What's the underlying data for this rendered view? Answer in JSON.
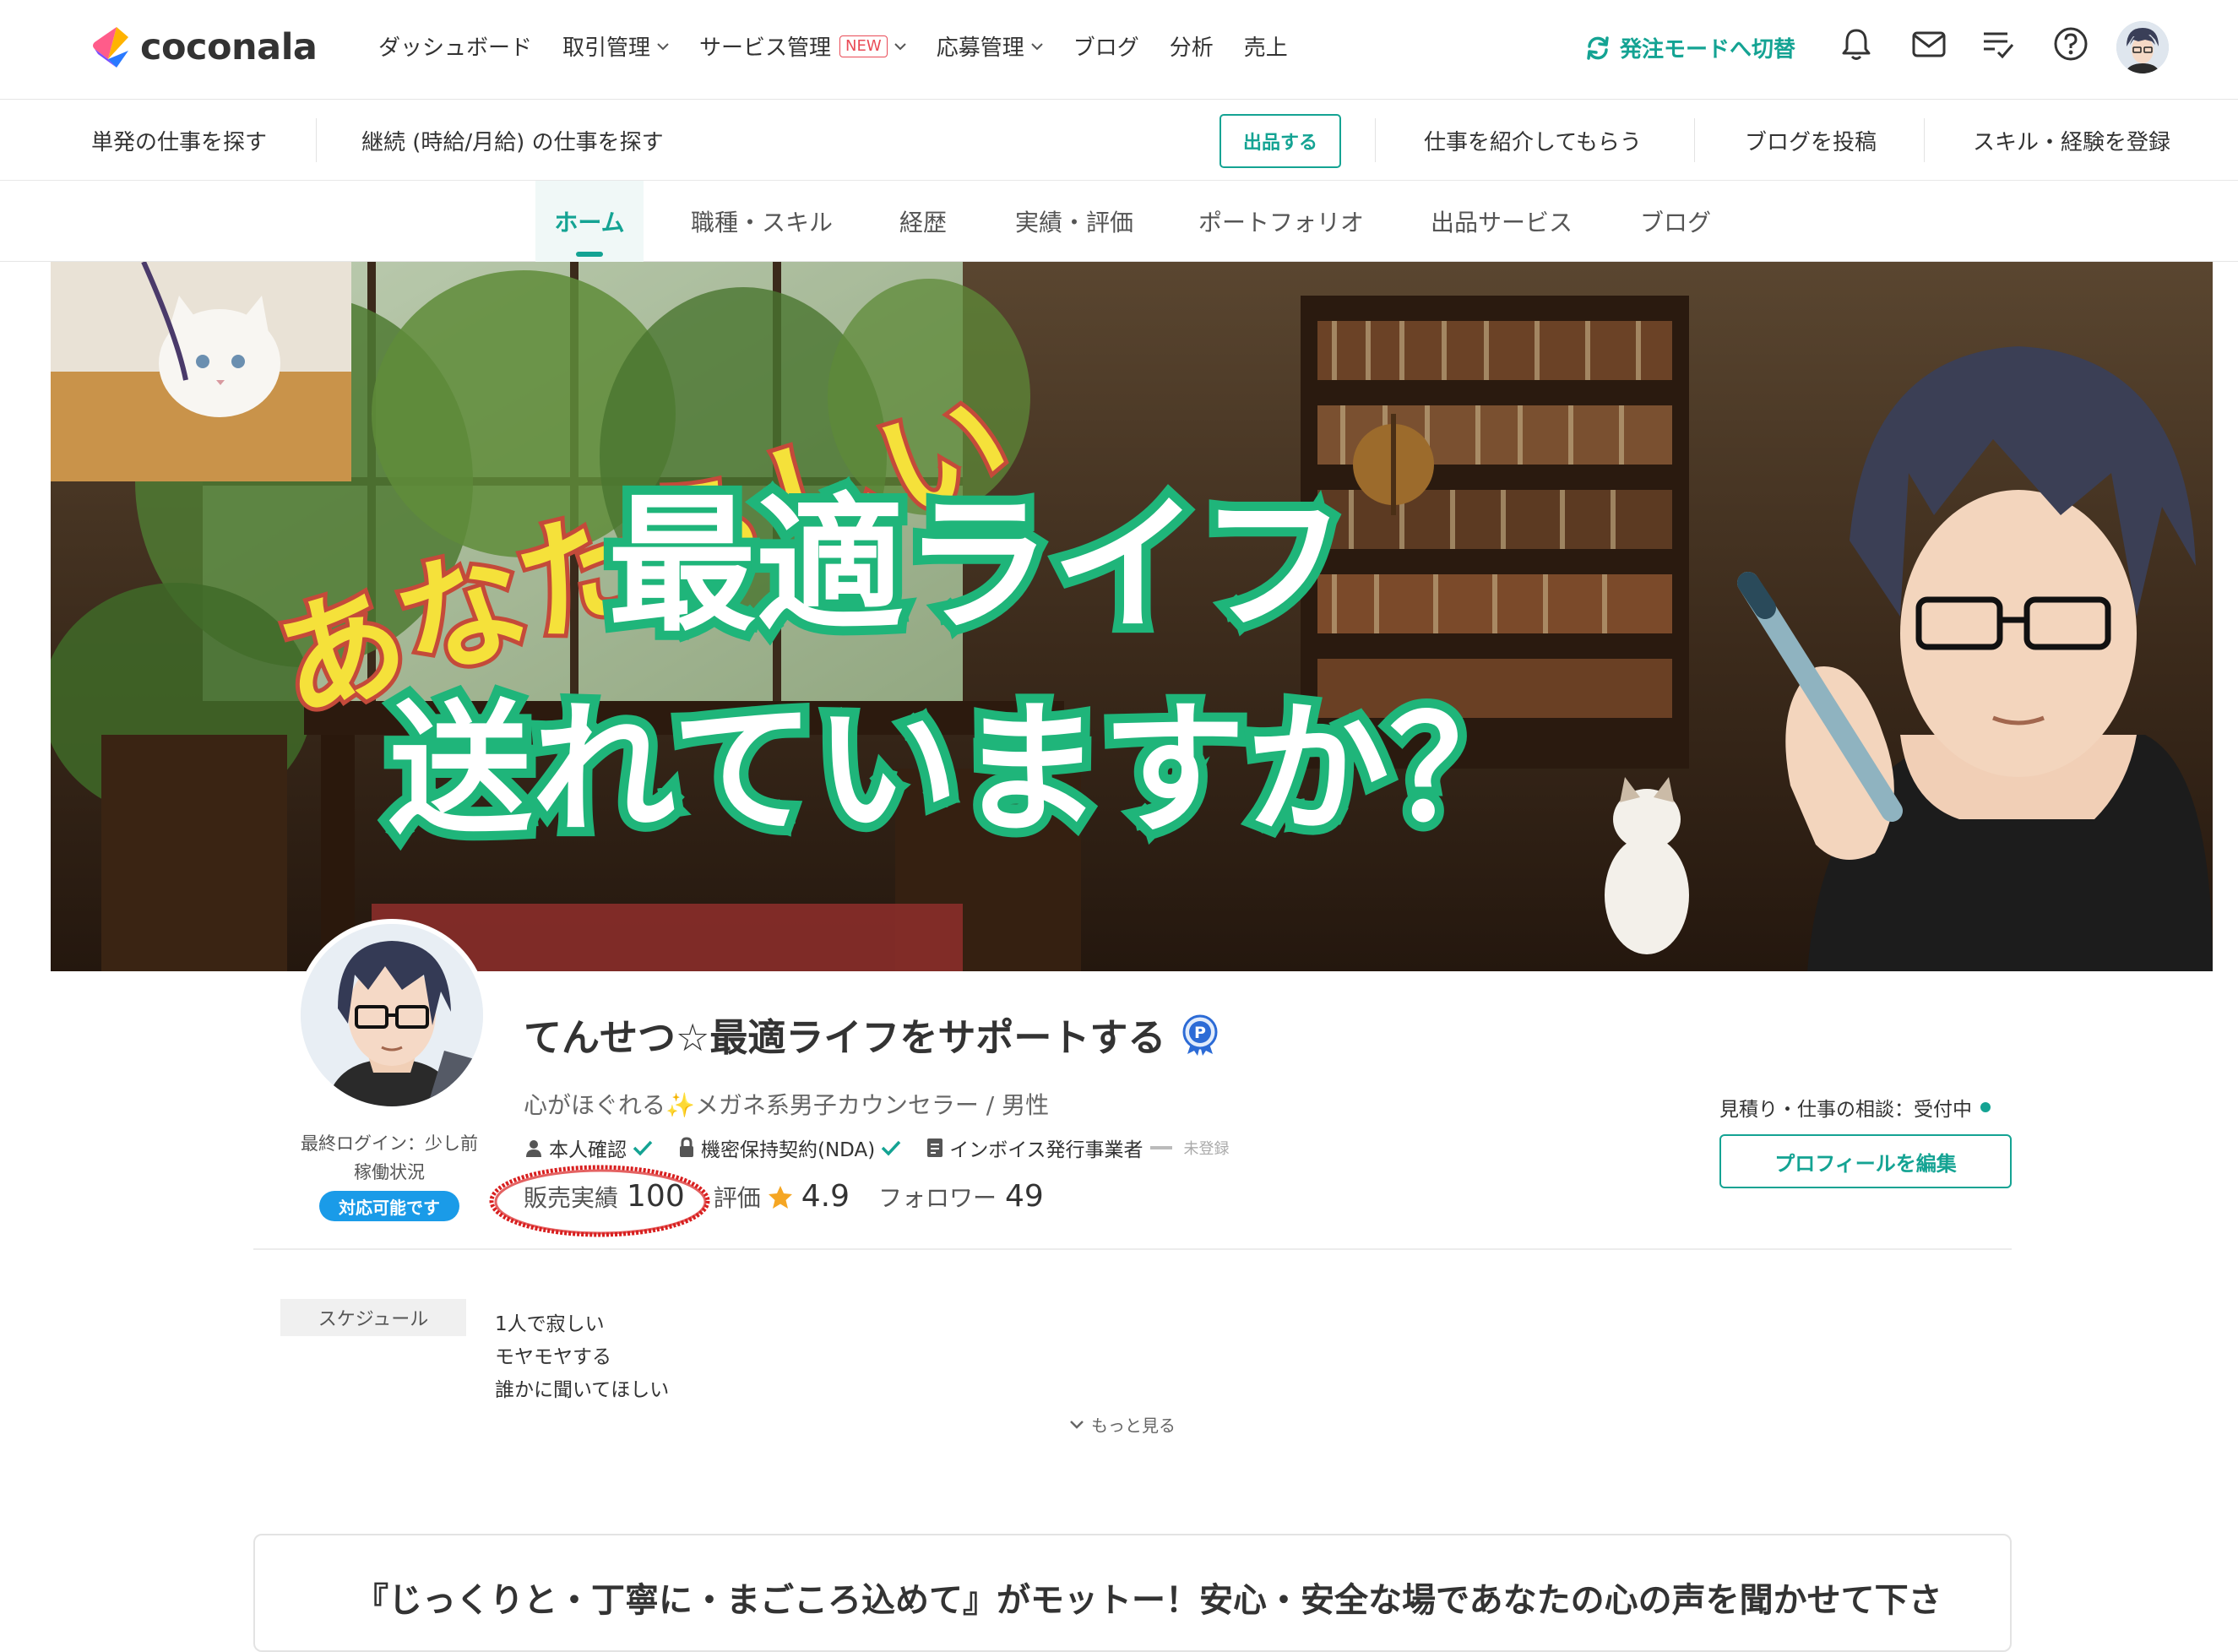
{
  "brand": {
    "name": "coconala"
  },
  "nav": {
    "items": [
      {
        "label": "ダッシュボード",
        "dropdown": false
      },
      {
        "label": "取引管理",
        "dropdown": true
      },
      {
        "label": "サービス管理",
        "badge": "NEW",
        "dropdown": true
      },
      {
        "label": "応募管理",
        "dropdown": true
      },
      {
        "label": "ブログ",
        "dropdown": false
      },
      {
        "label": "分析",
        "dropdown": false
      },
      {
        "label": "売上",
        "dropdown": false
      }
    ],
    "switch_mode_label": "発注モードへ切替",
    "icons": [
      "notification-bell-icon",
      "mail-icon",
      "todo-list-icon",
      "help-icon",
      "user-avatar"
    ]
  },
  "subnav": {
    "single_jobs": "単発の仕事を探す",
    "continuous_jobs": "継続 (時給/月給) の仕事を探す",
    "post_button": "出品する",
    "get_introduced": "仕事を紹介してもらう",
    "post_blog": "ブログを投稿",
    "register_skills": "スキル・経験を登録"
  },
  "profile_tabs": [
    {
      "label": "ホーム",
      "active": true
    },
    {
      "label": "職種・スキル",
      "active": false
    },
    {
      "label": "経歴",
      "active": false
    },
    {
      "label": "実績・評価",
      "active": false
    },
    {
      "label": "ポートフォリオ",
      "active": false
    },
    {
      "label": "出品サービス",
      "active": false
    },
    {
      "label": "ブログ",
      "active": false
    }
  ],
  "cover": {
    "line1": "あなたらしい",
    "line2": "最適ライフ",
    "line3": "送れていますか？"
  },
  "profile": {
    "name": "てんせつ☆最適ライフをサポートする",
    "catchphrase": "心がほぐれる✨メガネ系男子カウンセラー / 男性",
    "last_login": "最終ログイン：少し前",
    "activity_label": "稼働状況",
    "availability": "対応可能です",
    "verifications": {
      "identity": "本人確認",
      "nda": "機密保持契約(NDA)",
      "invoice": "インボイス発行事業者",
      "invoice_status": "未登録"
    },
    "stats": {
      "sales_label": "販売実績",
      "sales_value": "100",
      "rating_label": "評価",
      "rating_value": "4.9",
      "followers_label": "フォロワー",
      "followers_value": "49"
    },
    "consult_status": "見積り・仕事の相談：受付中",
    "edit_button": "プロフィールを編集"
  },
  "about": {
    "schedule_label": "スケジュール",
    "intro_lines": [
      "1人で寂しい",
      "モヤモヤする",
      "誰かに聞いてほしい"
    ],
    "show_more": "もっと見る"
  },
  "motto": "『じっくりと・丁寧に・まごころ込めて』がモットー！安心・安全な場であなたの心の声を聞かせて下さ",
  "colors": {
    "brand_green": "#14a393",
    "badge_blue": "#1a9be8",
    "new_red": "#e94b57",
    "annotation_red": "#d81f1f"
  }
}
